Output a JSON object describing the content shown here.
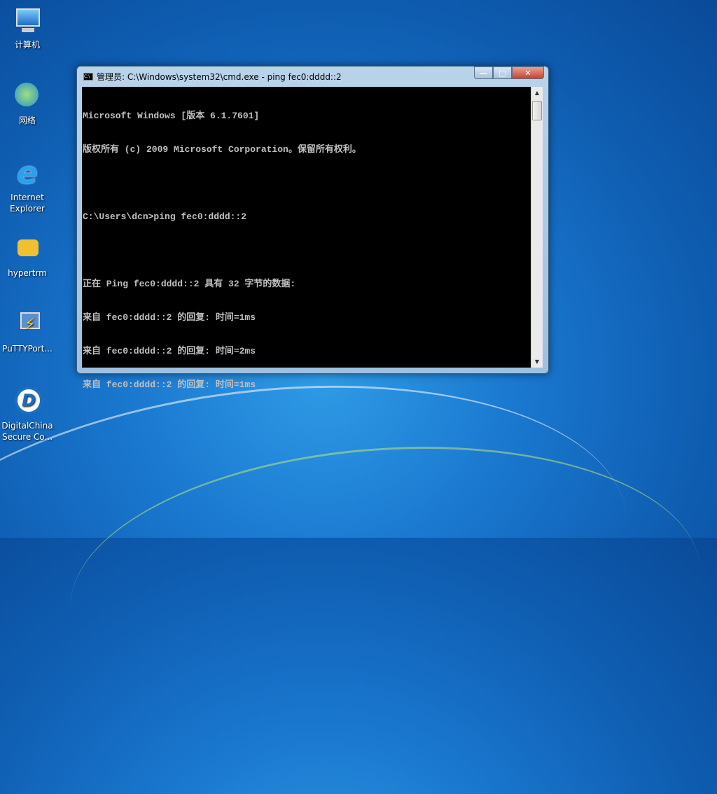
{
  "desktop": {
    "icons": [
      {
        "label": "计算机"
      },
      {
        "label": "网络"
      },
      {
        "label": "Internet Explorer"
      },
      {
        "label": "hypertrm"
      },
      {
        "label": "PuTTYPort..."
      },
      {
        "label": "DigitalChina Secure Co..."
      }
    ]
  },
  "window": {
    "title": "管理员: C:\\Windows\\system32\\cmd.exe - ping  fec0:dddd::2",
    "sys_icon": "C:\\",
    "minimize": "—",
    "maximize": "□",
    "close": "✕"
  },
  "console": {
    "lines": [
      "Microsoft Windows [版本 6.1.7601]",
      "版权所有 (c) 2009 Microsoft Corporation。保留所有权利。",
      "",
      "C:\\Users\\dcn>ping fec0:dddd::2",
      "",
      "正在 Ping fec0:dddd::2 具有 32 字节的数据:",
      "来自 fec0:dddd::2 的回复: 时间=1ms",
      "来自 fec0:dddd::2 的回复: 时间=2ms",
      "来自 fec0:dddd::2 的回复: 时间=1ms"
    ]
  },
  "scrollbar": {
    "up": "▲",
    "down": "▼"
  }
}
